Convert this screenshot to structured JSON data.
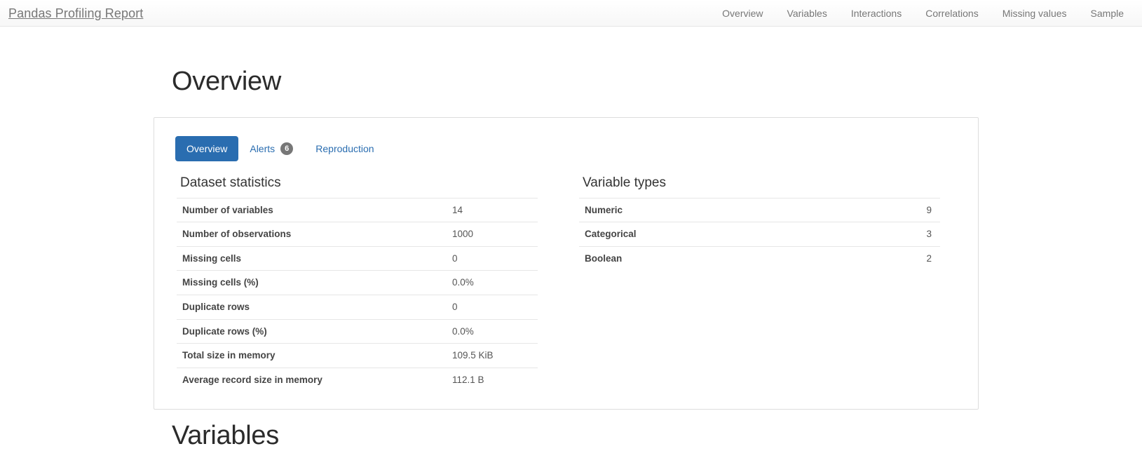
{
  "navbar": {
    "brand": "Pandas Profiling Report",
    "links": [
      {
        "label": "Overview"
      },
      {
        "label": "Variables"
      },
      {
        "label": "Interactions"
      },
      {
        "label": "Correlations"
      },
      {
        "label": "Missing values"
      },
      {
        "label": "Sample"
      }
    ]
  },
  "page": {
    "title": "Overview",
    "bottom_section_title": "Variables"
  },
  "colors": {
    "accent": "#2a6db0",
    "badge": "#777777",
    "card_border": "#dddddd",
    "navbar_text": "#777777"
  },
  "card": {
    "tabs": [
      {
        "label": "Overview",
        "active": true,
        "badge": ""
      },
      {
        "label": "Alerts",
        "active": false,
        "badge": "6"
      },
      {
        "label": "Reproduction",
        "active": false,
        "badge": ""
      }
    ],
    "dataset_statistics": {
      "heading": "Dataset statistics",
      "rows": [
        {
          "label": "Number of variables",
          "value": "14"
        },
        {
          "label": "Number of observations",
          "value": "1000"
        },
        {
          "label": "Missing cells",
          "value": "0"
        },
        {
          "label": "Missing cells (%)",
          "value": "0.0%"
        },
        {
          "label": "Duplicate rows",
          "value": "0"
        },
        {
          "label": "Duplicate rows (%)",
          "value": "0.0%"
        },
        {
          "label": "Total size in memory",
          "value": "109.5 KiB"
        },
        {
          "label": "Average record size in memory",
          "value": "112.1 B"
        }
      ]
    },
    "variable_types": {
      "heading": "Variable types",
      "rows": [
        {
          "label": "Numeric",
          "value": "9"
        },
        {
          "label": "Categorical",
          "value": "3"
        },
        {
          "label": "Boolean",
          "value": "2"
        }
      ]
    }
  }
}
